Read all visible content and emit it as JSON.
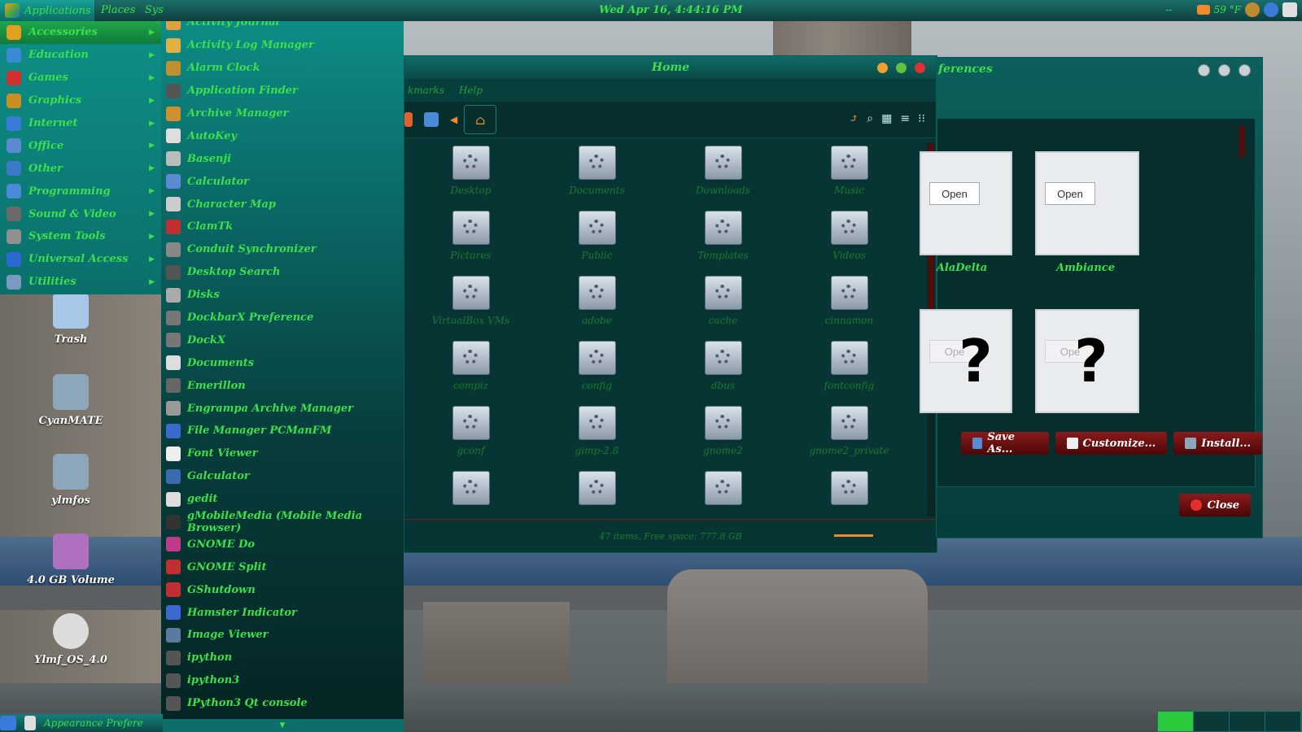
{
  "top_panel": {
    "menus": [
      "Applications",
      "Places",
      "Sys"
    ],
    "clock": "Wed Apr 16,  4:44:16 PM",
    "tray_separator": "--",
    "weather": "59 °F"
  },
  "categories": [
    {
      "label": "Accessories",
      "icon": "accessories-icon",
      "color": "#e0a020"
    },
    {
      "label": "Education",
      "icon": "education-icon",
      "color": "#3a8ad8"
    },
    {
      "label": "Games",
      "icon": "games-icon",
      "color": "#d03030"
    },
    {
      "label": "Graphics",
      "icon": "graphics-icon",
      "color": "#c89020"
    },
    {
      "label": "Internet",
      "icon": "internet-icon",
      "color": "#3a7ad8"
    },
    {
      "label": "Office",
      "icon": "office-icon",
      "color": "#5a8ad0"
    },
    {
      "label": "Other",
      "icon": "other-icon",
      "color": "#3a7ac8"
    },
    {
      "label": "Programming",
      "icon": "programming-icon",
      "color": "#4a8ad8"
    },
    {
      "label": "Sound & Video",
      "icon": "sound-video-icon",
      "color": "#6a6a6a"
    },
    {
      "label": "System Tools",
      "icon": "system-tools-icon",
      "color": "#909090"
    },
    {
      "label": "Universal Access",
      "icon": "universal-access-icon",
      "color": "#2a6ad0"
    },
    {
      "label": "Utilities",
      "icon": "utilities-icon",
      "color": "#7a9ac0"
    }
  ],
  "accessories": [
    {
      "label": "Activity Journal",
      "color": "#e0a040"
    },
    {
      "label": "Activity Log Manager",
      "color": "#e0b040"
    },
    {
      "label": "Alarm Clock",
      "color": "#c09030"
    },
    {
      "label": "Application Finder",
      "color": "#555"
    },
    {
      "label": "Archive Manager",
      "color": "#d09030"
    },
    {
      "label": "AutoKey",
      "color": "#ddd"
    },
    {
      "label": "Basenji",
      "color": "#bbb"
    },
    {
      "label": "Calculator",
      "color": "#5a8ad0"
    },
    {
      "label": "Character Map",
      "color": "#ccc"
    },
    {
      "label": "ClamTk",
      "color": "#c03030"
    },
    {
      "label": "Conduit Synchronizer",
      "color": "#888"
    },
    {
      "label": "Desktop Search",
      "color": "#555"
    },
    {
      "label": "Disks",
      "color": "#aaa"
    },
    {
      "label": "DockbarX Preference",
      "color": "#777"
    },
    {
      "label": "DockX",
      "color": "#777"
    },
    {
      "label": "Documents",
      "color": "#ddd"
    },
    {
      "label": "Emerillon",
      "color": "#666"
    },
    {
      "label": "Engrampa Archive Manager",
      "color": "#999"
    },
    {
      "label": "File Manager PCManFM",
      "color": "#3a6ad0"
    },
    {
      "label": "Font Viewer",
      "color": "#eee"
    },
    {
      "label": "Galculator",
      "color": "#3a6ab0"
    },
    {
      "label": "gedit",
      "color": "#ddd"
    },
    {
      "label": "gMobileMedia (Mobile Media Browser)",
      "color": "#333"
    },
    {
      "label": "GNOME Do",
      "color": "#c03a8a"
    },
    {
      "label": "GNOME Split",
      "color": "#c03030"
    },
    {
      "label": "GShutdown",
      "color": "#c03030"
    },
    {
      "label": "Hamster Indicator",
      "color": "#3a6ad0"
    },
    {
      "label": "Image Viewer",
      "color": "#5a7aa0"
    },
    {
      "label": "ipython",
      "color": "#555"
    },
    {
      "label": "ipython3",
      "color": "#555"
    },
    {
      "label": "IPython3 Qt console",
      "color": "#555"
    }
  ],
  "desktop_icons": [
    {
      "label": "Trash",
      "color": "#a8c8e8"
    },
    {
      "label": "CyanMATE",
      "color": "#8ea6ba"
    },
    {
      "label": "ylmfos",
      "color": "#8ea6ba"
    },
    {
      "label": "4.0 GB Volume",
      "color": "#b070c0"
    },
    {
      "label": "Ylmf_OS_4.0",
      "color": "#dcdcdc"
    }
  ],
  "file_manager": {
    "title": "Home",
    "menu": [
      "kmarks",
      "Help"
    ],
    "items": [
      "Desktop",
      "Documents",
      "Downloads",
      "Music",
      "Pictures",
      "Public",
      "Templates",
      "Videos",
      "VirtualBox VMs",
      "adobe",
      "cache",
      "cinnamon",
      "compiz",
      "config",
      "dbus",
      "fontconfig",
      "gconf",
      "gimp-2.8",
      "gnome2",
      "gnome2_private",
      "",
      "",
      "",
      ""
    ],
    "status": "47 items, Free space: 777.8 GB"
  },
  "appearance": {
    "title": "ferences",
    "themes": [
      {
        "name": "AlaDelta",
        "open_label": "Open"
      },
      {
        "name": "Ambiance",
        "open_label": "Open"
      },
      {
        "name": "",
        "open_label": "Ope"
      },
      {
        "name": "",
        "open_label": "Ope"
      }
    ],
    "buttons": {
      "save_as": "Save As...",
      "customize": "Customize...",
      "install": "Install...",
      "close": "Close"
    }
  },
  "bottom_panel": {
    "taskbar_label": "Appearance Prefere"
  }
}
